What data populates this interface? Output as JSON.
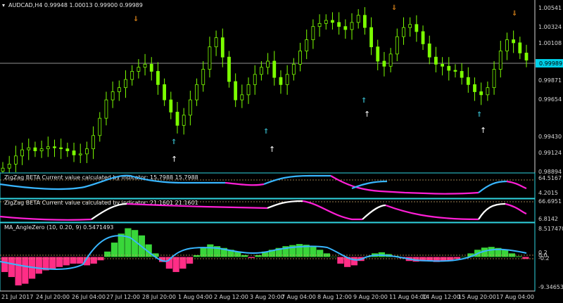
{
  "window": {
    "title": "AUDCAD,H4  0.99948 1.00013 0.99900 0.99989",
    "current_price": "0.99989"
  },
  "colors": {
    "background": "#000000",
    "candle": "#7CFF00",
    "border": "#2fd3e0",
    "zigzag_blue": "#38b6ff",
    "zigzag_magenta": "#ff1fd6",
    "zigzag_white": "#ffffff",
    "hist_green": "#39d63a",
    "hist_pink": "#ff2d86",
    "arrow_cyan": "#3fd3e6",
    "arrow_orange": "#ff9a1f"
  },
  "price_axis": [
    "1.00541",
    "1.00324",
    "1.00108",
    "0.99871",
    "0.99654",
    "0.99430",
    "0.99124",
    "0.98894"
  ],
  "panels": {
    "zigzag1": {
      "title": "ZigZag BETA Current value calculated by indicator: 15.7988 15.7988",
      "levels": [
        "64.5167",
        "4.2015"
      ]
    },
    "zigzag2": {
      "title": "ZigZag BETA Current value calculated by indicator: 21.1601 21.1601",
      "levels": [
        "66.6951",
        "6.8142"
      ]
    },
    "angle": {
      "title": "MA_AngleZero (10, 0.20, 9) 0.5471493",
      "levels": [
        "8.517470",
        "0.2",
        "0.0",
        "-0.2",
        "-9.346535"
      ]
    }
  },
  "time_axis": [
    "21 Jul 2017",
    "24 Jul 20:00",
    "26 Jul 04:00",
    "27 Jul 12:00",
    "28 Jul 20:00",
    "1 Aug 04:00",
    "2 Aug 12:00",
    "3 Aug 20:00",
    "7 Aug 04:00",
    "8 Aug 12:00",
    "9 Aug 20:00",
    "11 Aug 04:00",
    "14 Aug 12:00",
    "15 Aug 20:00",
    "17 Aug 04:00"
  ],
  "chart_data": {
    "type": "candlestick",
    "symbol": "AUDCAD",
    "timeframe": "H4",
    "ohlc_header": [
      0.99948,
      1.00013,
      0.999,
      0.99989
    ],
    "price_ticks": [
      1.00541,
      1.00324,
      1.00108,
      0.99871,
      0.99654,
      0.9943,
      0.99124,
      0.98894
    ],
    "time_ticks": [
      "21 Jul 2017",
      "24 Jul 20:00",
      "26 Jul 04:00",
      "27 Jul 12:00",
      "28 Jul 20:00",
      "1 Aug 04:00",
      "2 Aug 12:00",
      "3 Aug 20:00",
      "7 Aug 04:00",
      "8 Aug 12:00",
      "9 Aug 20:00",
      "11 Aug 04:00",
      "14 Aug 12:00",
      "15 Aug 20:00",
      "17 Aug 04:00"
    ],
    "close_path": [
      0.9893,
      0.9897,
      0.9905,
      0.9911,
      0.9913,
      0.991,
      0.9912,
      0.9914,
      0.9913,
      0.9912,
      0.991,
      0.9906,
      0.9907,
      0.9912,
      0.9925,
      0.9942,
      0.996,
      0.9968,
      0.9972,
      0.998,
      0.9988,
      0.9992,
      0.9995,
      0.9988,
      0.9975,
      0.996,
      0.9948,
      0.9935,
      0.9945,
      0.996,
      0.9975,
      0.999,
      1.0012,
      1.0021,
      1.0002,
      0.9978,
      0.996,
      0.9965,
      0.9975,
      0.9985,
      0.9992,
      0.9998,
      0.9982,
      0.9975,
      0.9985,
      0.9995,
      1.0008,
      1.0019,
      1.0032,
      1.0035,
      1.0038,
      1.0036,
      1.0032,
      1.0029,
      1.0036,
      1.0043,
      1.0031,
      1.0012,
      0.9998,
      0.9993,
      1.0005,
      1.0022,
      1.0031,
      1.0034,
      1.0027,
      1.0015,
      1.0002,
      0.9995,
      0.9993,
      0.9989,
      0.9988,
      0.9982,
      0.9975,
      0.9968,
      0.9965,
      0.9972,
      0.999,
      1.0008,
      1.0019,
      1.0016,
      1.0006,
      0.9999
    ],
    "angle_hist": [
      -4.5,
      -6,
      -8.5,
      -8,
      -6.5,
      -5,
      -4,
      -3.5,
      -3,
      -2.5,
      -2,
      -2,
      -2.5,
      -2,
      -1,
      1.5,
      4,
      6.5,
      8,
      7.5,
      6,
      3.5,
      1,
      -1.5,
      -3.5,
      -4.5,
      -3.5,
      -2,
      0.5,
      2.5,
      3.5,
      3,
      2.5,
      2,
      1.5,
      0.5,
      -0.3,
      0.5,
      1.5,
      2,
      2.5,
      3,
      3.3,
      3.6,
      3.4,
      2.8,
      2,
      1,
      0,
      -2,
      -3,
      -2.5,
      -1.2,
      0,
      1,
      1.3,
      0.8,
      0.3,
      -0.4,
      -1.2,
      -1.4,
      -1.3,
      -1.2,
      -1.5,
      -1.3,
      -1,
      -0.6,
      0,
      1,
      2,
      2.6,
      2.8,
      2.5,
      2,
      1,
      0.2,
      -0.6
    ]
  }
}
